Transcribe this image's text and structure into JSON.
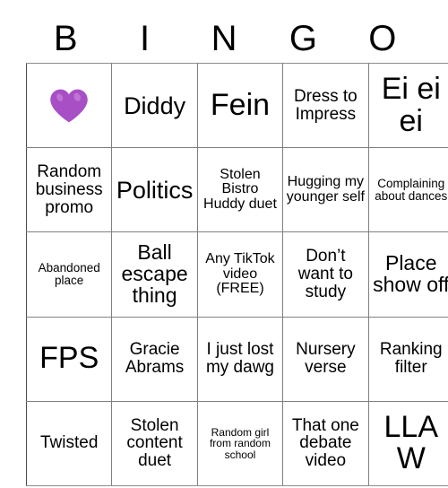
{
  "card": {
    "header_letters": [
      "B",
      "I",
      "N",
      "G",
      "O"
    ],
    "heart_color": "#A84FC6",
    "heart_highlight": "#C47BD8",
    "rows": [
      [
        {
          "text": "",
          "icon": "purple-heart-icon",
          "size": "xl"
        },
        {
          "text": "Diddy",
          "size": "xl"
        },
        {
          "text": "Fein",
          "size": "xxl"
        },
        {
          "text": "Dress to Impress",
          "size": "md"
        },
        {
          "text": "Ei ei ei",
          "size": "xxl"
        }
      ],
      [
        {
          "text": "Random business promo",
          "size": "md"
        },
        {
          "text": "Politics",
          "size": "xl"
        },
        {
          "text": "Stolen Bistro Huddy duet",
          "size": "sm"
        },
        {
          "text": "Hugging my younger self",
          "size": "sm"
        },
        {
          "text": "Complaining about dances",
          "size": "xs"
        }
      ],
      [
        {
          "text": "Abandoned place",
          "size": "xs"
        },
        {
          "text": "Ball escape thing",
          "size": "lg"
        },
        {
          "text": "Any TikTok video (FREE)",
          "size": "sm"
        },
        {
          "text": "Don’t want to study",
          "size": "md"
        },
        {
          "text": "Place show off",
          "size": "lg"
        }
      ],
      [
        {
          "text": "FPS",
          "size": "xxl"
        },
        {
          "text": "Gracie Abrams",
          "size": "md"
        },
        {
          "text": "I just lost my dawg",
          "size": "md"
        },
        {
          "text": "Nursery verse",
          "size": "md"
        },
        {
          "text": "Ranking filter",
          "size": "md"
        }
      ],
      [
        {
          "text": "Twisted",
          "size": "md"
        },
        {
          "text": "Stolen content duet",
          "size": "md"
        },
        {
          "text": "Random girl from random school",
          "size": "xxs"
        },
        {
          "text": "That one debate video",
          "size": "md"
        },
        {
          "text": "LLAW",
          "size": "xxl"
        }
      ]
    ]
  }
}
